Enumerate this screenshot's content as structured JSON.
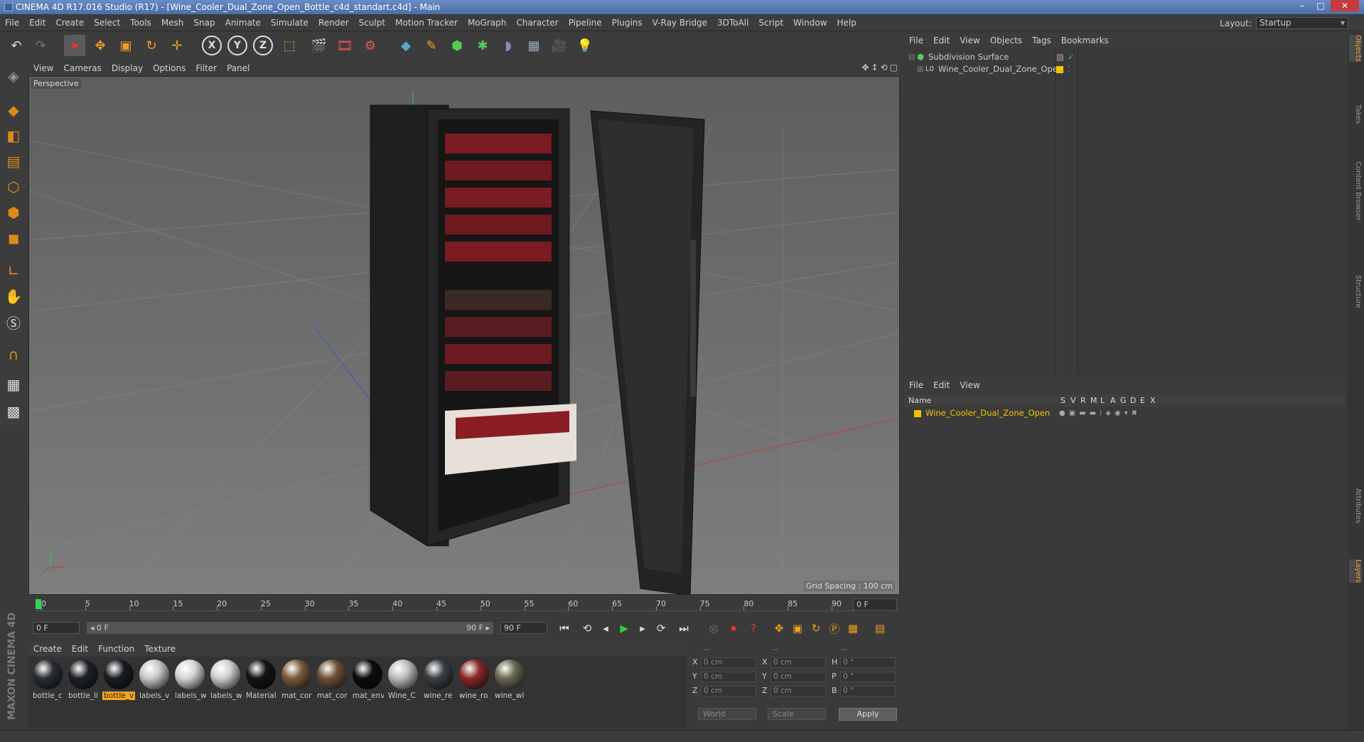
{
  "window": {
    "title": "CINEMA 4D R17.016 Studio (R17) - [Wine_Cooler_Dual_Zone_Open_Bottle_c4d_standart.c4d] - Main",
    "minimize": "–",
    "maximize": "□",
    "close": "✕"
  },
  "menubar": [
    "File",
    "Edit",
    "Create",
    "Select",
    "Tools",
    "Mesh",
    "Snap",
    "Animate",
    "Simulate",
    "Render",
    "Sculpt",
    "Motion Tracker",
    "MoGraph",
    "Character",
    "Pipeline",
    "Plugins",
    "V-Ray Bridge",
    "3DToAll",
    "Script",
    "Window",
    "Help"
  ],
  "layout": {
    "label": "Layout:",
    "value": "Startup"
  },
  "toolbar": {
    "axis_x": "X",
    "axis_y": "Y",
    "axis_z": "Z"
  },
  "viewport": {
    "menu": [
      "View",
      "Cameras",
      "Display",
      "Options",
      "Filter",
      "Panel"
    ],
    "label": "Perspective",
    "grid_spacing": "Grid Spacing : 100 cm"
  },
  "timeline": {
    "ticks": [
      "0",
      "5",
      "10",
      "15",
      "20",
      "25",
      "30",
      "35",
      "40",
      "45",
      "50",
      "55",
      "60",
      "65",
      "70",
      "75",
      "80",
      "85",
      "90"
    ],
    "current_frame": "0 F",
    "start_field": "0 F",
    "range_start": "◂ 0 F",
    "range_end": "90 F ▸",
    "end_field": "90 F"
  },
  "materials": {
    "menu": [
      "Create",
      "Edit",
      "Function",
      "Texture"
    ],
    "items": [
      {
        "name": "bottle_c",
        "color": "#2a2f36"
      },
      {
        "name": "bottle_li",
        "color": "#1e2228"
      },
      {
        "name": "bottle_v",
        "color": "#1a1d22",
        "selected": true
      },
      {
        "name": "labels_v",
        "color": "#c9c9c9"
      },
      {
        "name": "labels_w",
        "color": "#d6d6d6"
      },
      {
        "name": "labels_w",
        "color": "#cfcfcf"
      },
      {
        "name": "Material",
        "color": "#141414"
      },
      {
        "name": "mat_cor",
        "color": "#7a5a3c"
      },
      {
        "name": "mat_cor",
        "color": "#6e5236"
      },
      {
        "name": "mat_env",
        "color": "#0c0c0c"
      },
      {
        "name": "Wine_C",
        "color": "#bdbdbd"
      },
      {
        "name": "wine_re",
        "color": "#3a3f44"
      },
      {
        "name": "wine_ro",
        "color": "#8a2a2a"
      },
      {
        "name": "wine_wl",
        "color": "#6b6a52"
      }
    ]
  },
  "coords": {
    "header": [
      "--",
      "--",
      "--"
    ],
    "rows": [
      {
        "l1": "X",
        "v1": "0 cm",
        "l2": "X",
        "v2": "0 cm",
        "l3": "H",
        "v3": "0 °"
      },
      {
        "l1": "Y",
        "v1": "0 cm",
        "l2": "Y",
        "v2": "0 cm",
        "l3": "P",
        "v3": "0 °"
      },
      {
        "l1": "Z",
        "v1": "0 cm",
        "l2": "Z",
        "v2": "0 cm",
        "l3": "B",
        "v3": "0 °"
      }
    ],
    "mode1": "World",
    "mode2": "Scale",
    "apply": "Apply"
  },
  "objects": {
    "menu": [
      "File",
      "Edit",
      "View",
      "Objects",
      "Tags",
      "Bookmarks"
    ],
    "items": [
      {
        "name": "Subdivision Surface"
      },
      {
        "name": "Wine_Cooler_Dual_Zone_Open"
      }
    ]
  },
  "layers": {
    "menu": [
      "File",
      "Edit",
      "View"
    ],
    "columns": [
      "Name",
      "S",
      "V",
      "R",
      "M",
      "L",
      "A",
      "G",
      "D",
      "E",
      "X"
    ],
    "items": [
      {
        "name": "Wine_Cooler_Dual_Zone_Open",
        "color": "#f2c400"
      }
    ]
  },
  "side_tabs": [
    "Objects",
    "Takes",
    "Content Browser",
    "Structure",
    "Attributes",
    "Layers"
  ],
  "brand": "MAXON CINEMA 4D",
  "colors": {
    "accent": "#f7a51c",
    "title_bar": "#4a6ea8",
    "bg": "#3a3a3a"
  }
}
